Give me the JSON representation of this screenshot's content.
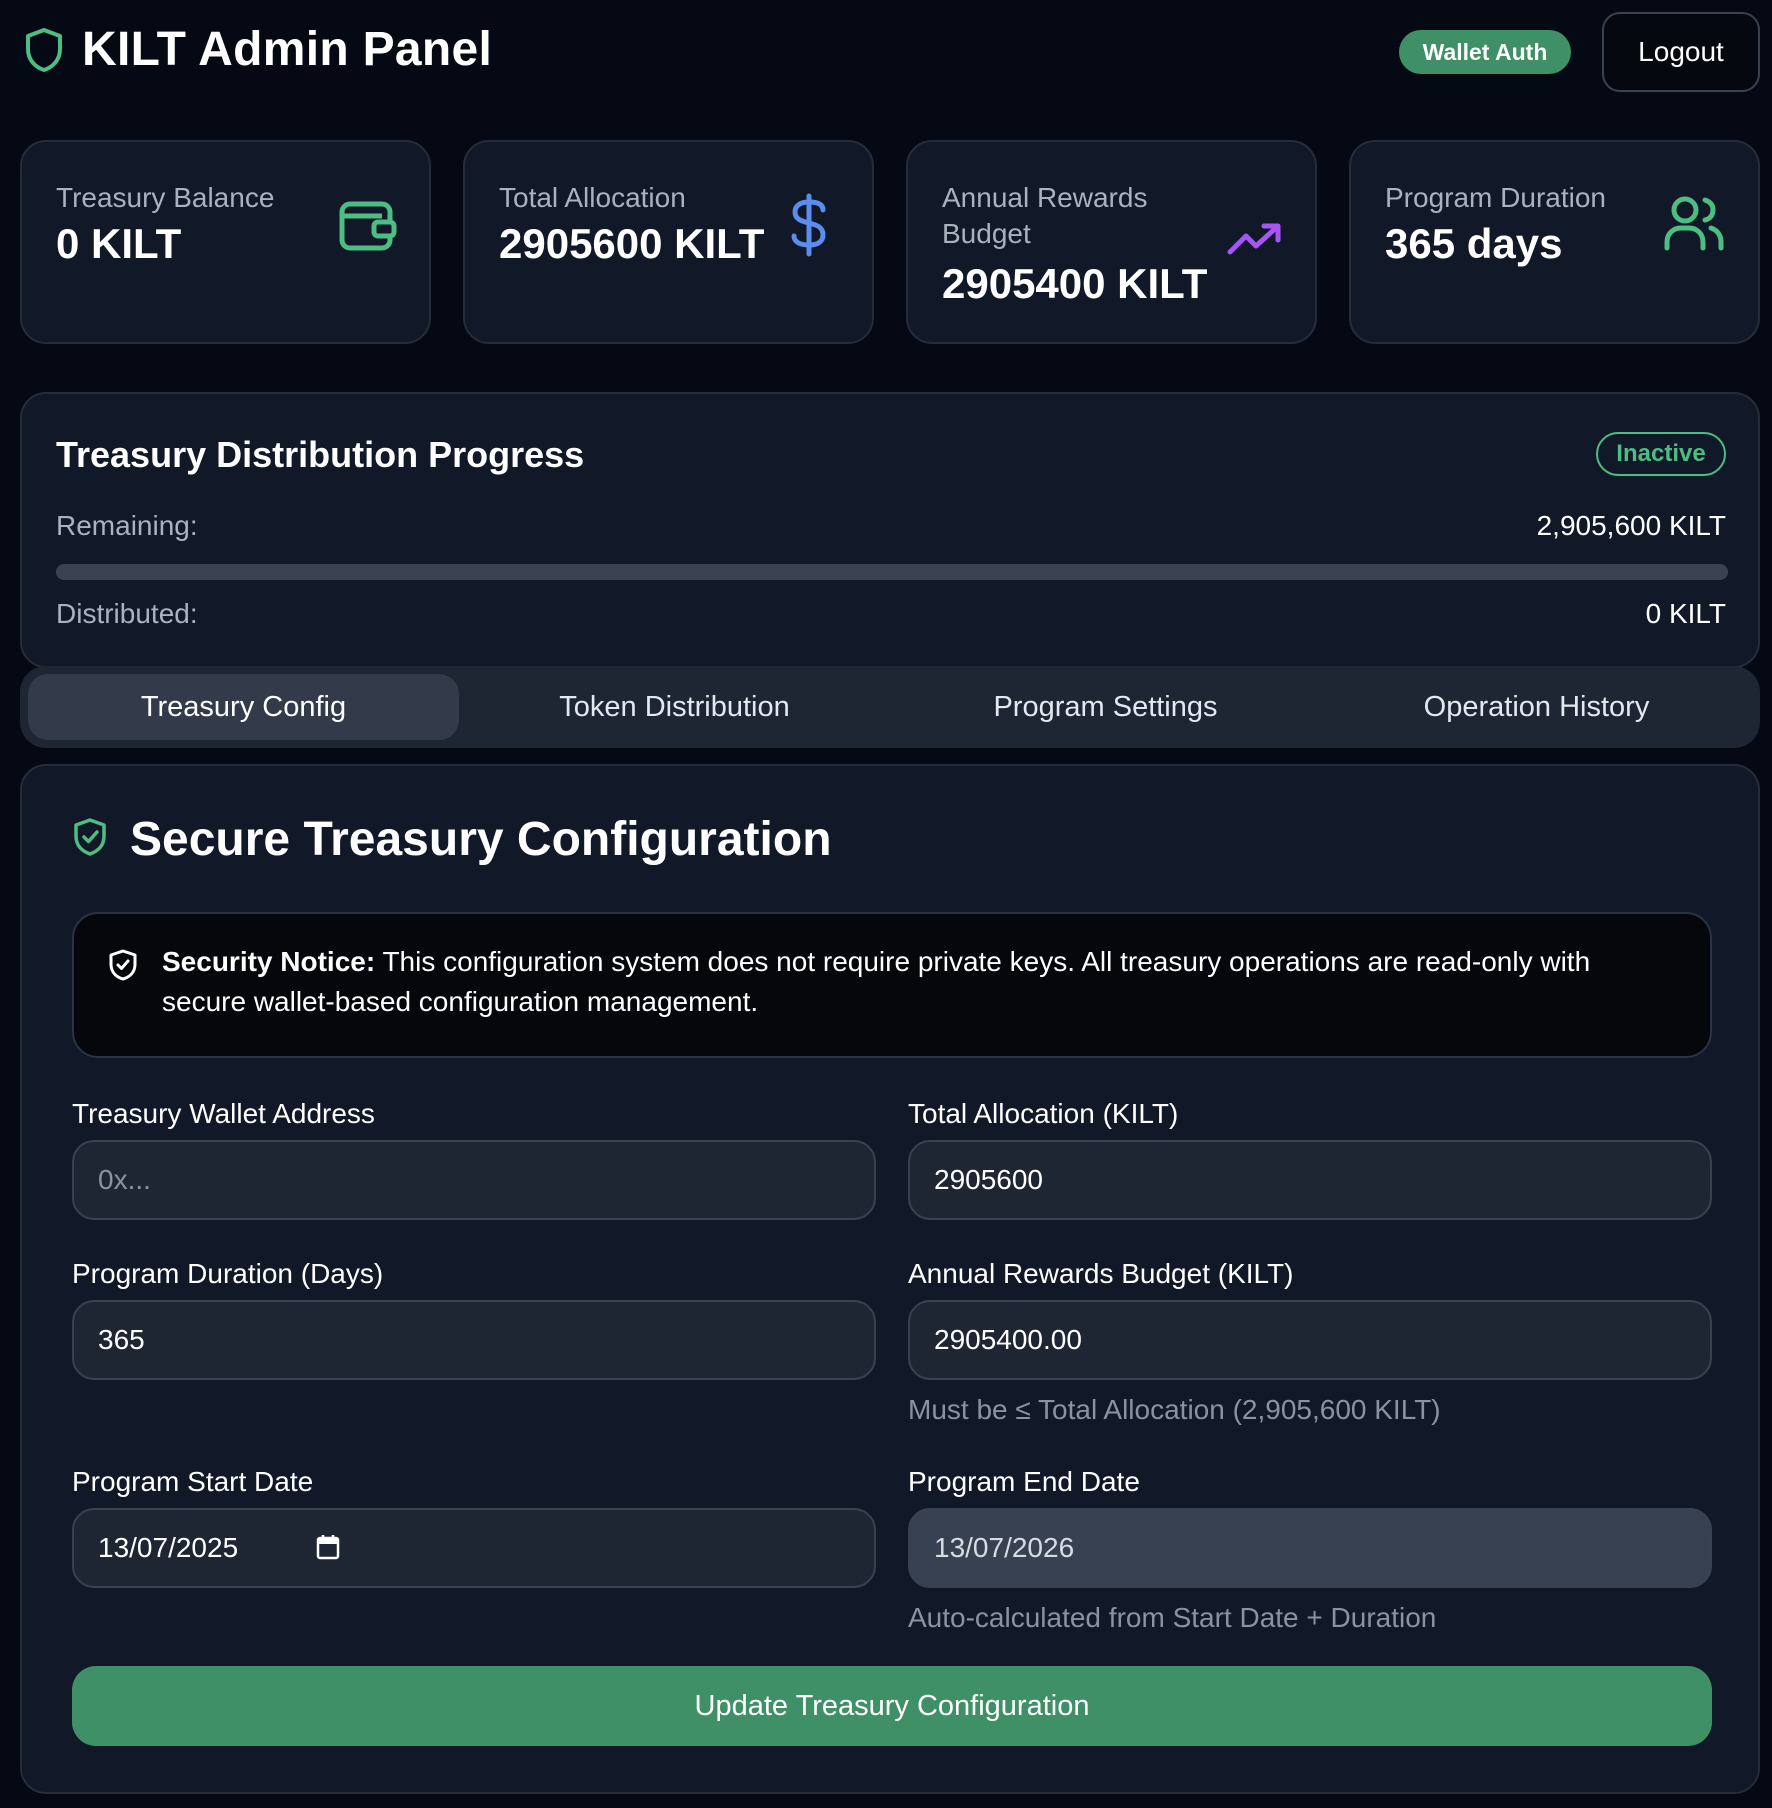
{
  "header": {
    "title": "KILT Admin Panel",
    "auth_badge": "Wallet Auth",
    "logout_label": "Logout"
  },
  "stats": [
    {
      "label": "Treasury Balance",
      "value": "0 KILT",
      "icon": "wallet-icon",
      "icon_color": "#4dbd83"
    },
    {
      "label": "Total Allocation",
      "value": "2905600 KILT",
      "icon": "dollar-icon",
      "icon_color": "#5b8def"
    },
    {
      "label": "Annual Rewards Budget",
      "value": "2905400 KILT",
      "icon": "trending-up-icon",
      "icon_color": "#a855f7"
    },
    {
      "label": "Program Duration",
      "value": "365 days",
      "icon": "users-icon",
      "icon_color": "#4dbd83"
    }
  ],
  "progress": {
    "title": "Treasury Distribution Progress",
    "status": "Inactive",
    "remaining_label": "Remaining:",
    "remaining_value": "2,905,600 KILT",
    "distributed_label": "Distributed:",
    "distributed_value": "0 KILT",
    "distributed_fraction": 0
  },
  "tabs": [
    {
      "label": "Treasury Config",
      "active": true
    },
    {
      "label": "Token Distribution",
      "active": false
    },
    {
      "label": "Program Settings",
      "active": false
    },
    {
      "label": "Operation History",
      "active": false
    }
  ],
  "config": {
    "title": "Secure Treasury Configuration",
    "notice_bold": "Security Notice:",
    "notice_text": " This configuration system does not require private keys. All treasury operations are read-only with secure wallet-based configuration management.",
    "fields": {
      "wallet_address": {
        "label": "Treasury Wallet Address",
        "placeholder": "0x...",
        "value": ""
      },
      "total_allocation": {
        "label": "Total Allocation (KILT)",
        "value": "2905600"
      },
      "duration": {
        "label": "Program Duration (Days)",
        "value": "365"
      },
      "annual_budget": {
        "label": "Annual Rewards Budget (KILT)",
        "value": "2905400.00",
        "hint": "Must be ≤ Total Allocation (2,905,600 KILT)"
      },
      "start_date": {
        "label": "Program Start Date",
        "value": "13/07/2025"
      },
      "end_date": {
        "label": "Program End Date",
        "value": "13/07/2026",
        "hint": "Auto-calculated from Start Date + Duration"
      }
    },
    "submit_label": "Update Treasury Configuration"
  },
  "colors": {
    "background": "#050914",
    "card": "#111827",
    "accent_green": "#3f9066",
    "status_green": "#4dbd83"
  }
}
